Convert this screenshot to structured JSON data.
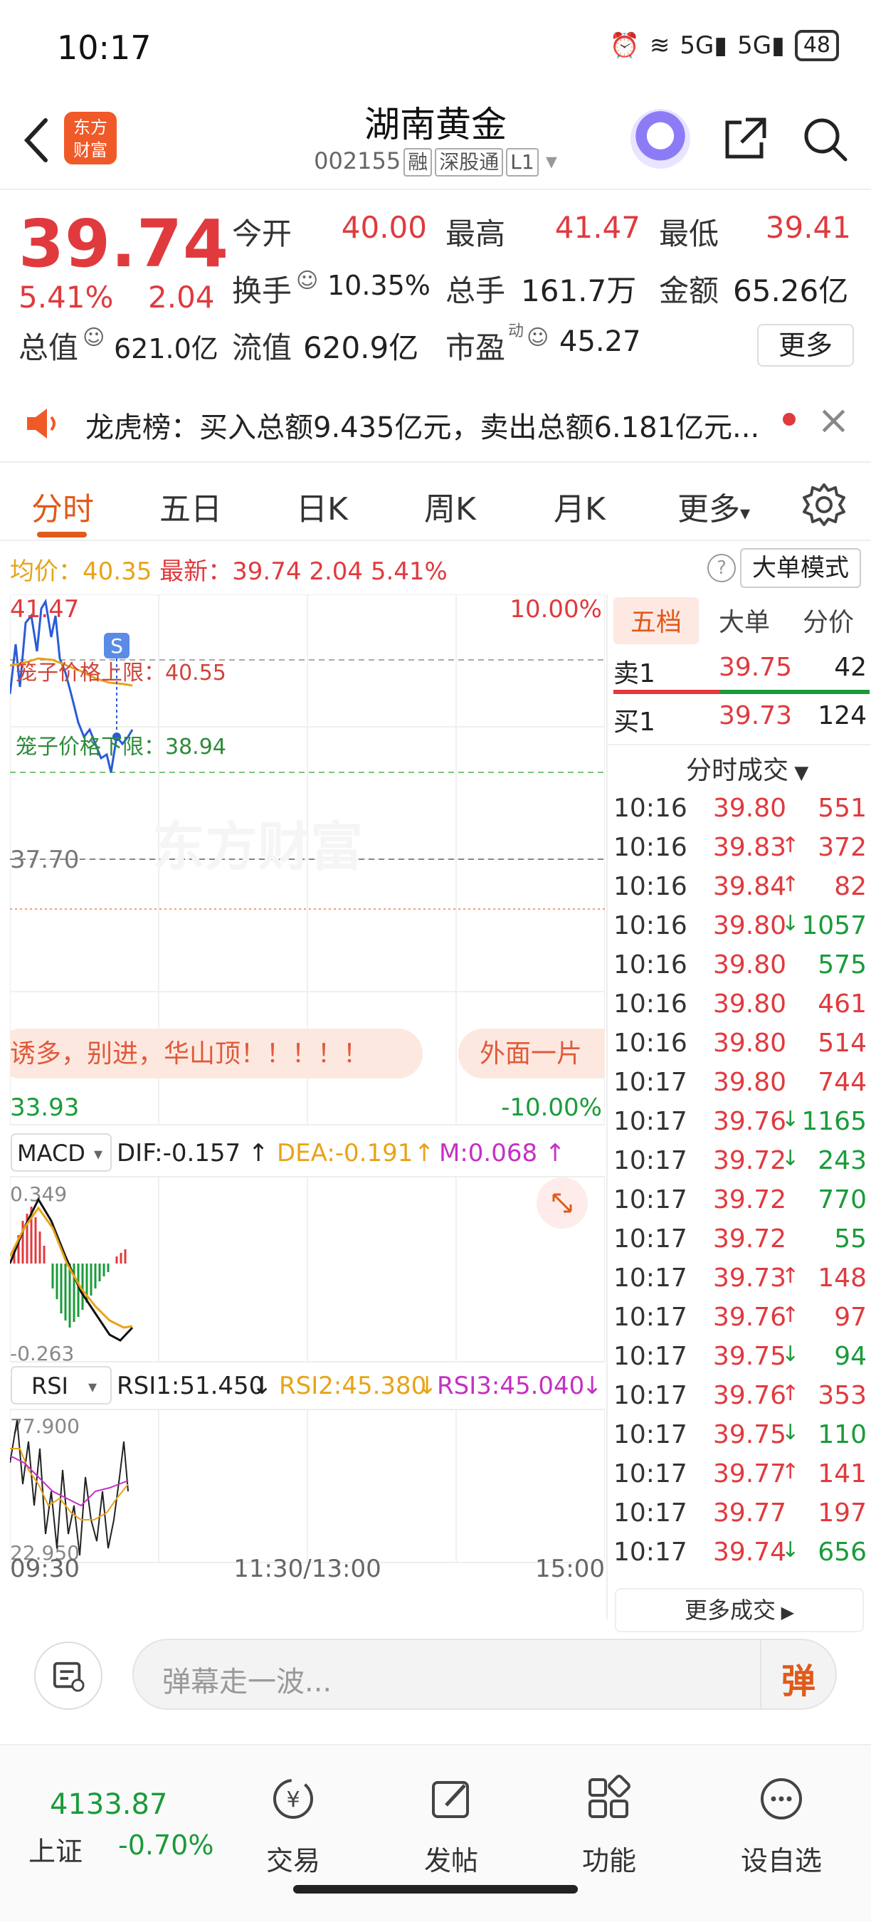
{
  "status_bar": {
    "time": "10:17",
    "signal_1": "5G",
    "signal_2": "5G",
    "battery": "48"
  },
  "header": {
    "logo_text": "东方\n财富",
    "stock_name": "湖南黄金",
    "stock_code": "002155",
    "tags": [
      "融",
      "深股通",
      "L1"
    ]
  },
  "quote": {
    "price": "39.74",
    "change_pct": "5.41%",
    "change": "2.04",
    "stats": [
      {
        "label": "今开",
        "value": "40.00",
        "color": "red"
      },
      {
        "label": "最高",
        "value": "41.47",
        "color": "red"
      },
      {
        "label": "最低",
        "value": "39.41",
        "color": "red"
      },
      {
        "label": "换手",
        "value": "10.35%",
        "color": "dark"
      },
      {
        "label": "总手",
        "value": "161.7万",
        "color": "dark"
      },
      {
        "label": "金额",
        "value": "65.26亿",
        "color": "dark"
      },
      {
        "label": "总值",
        "value": "621.0亿",
        "color": "dark"
      },
      {
        "label": "流值",
        "value": "620.9亿",
        "color": "dark"
      },
      {
        "label": "市盈",
        "value": "45.27",
        "color": "dark"
      }
    ],
    "pe_superscript": "动",
    "more_label": "更多"
  },
  "notice": {
    "text": "龙虎榜：买入总额9.435亿元，卖出总额6.181亿元..."
  },
  "tabs": [
    "分时",
    "五日",
    "日K",
    "周K",
    "月K",
    "更多"
  ],
  "info_line": {
    "avg_label": "均价：",
    "avg_value": "40.35",
    "latest_label": "最新：",
    "latest_value": "39.74",
    "change": "2.04",
    "change_pct": "5.41%",
    "mode_button": "大单模式"
  },
  "chart": {
    "top_price": "41.47",
    "top_pct": "10.00%",
    "cage_upper": "笼子价格上限：40.55",
    "cage_lower": "笼子价格下限：38.94",
    "mid_price": "37.70",
    "bottom_price": "33.93",
    "bottom_pct": "-10.00%",
    "watermark": "东方财富",
    "danmu_1": "诱多，别进，华山顶！！！！！",
    "danmu_2": "外面一片",
    "marker": "S",
    "macd": {
      "name": "MACD",
      "dif": "DIF:-0.157",
      "dea": "DEA:-0.191",
      "m": "M:0.068",
      "top": "0.349",
      "bottom": "-0.263"
    },
    "rsi": {
      "name": "RSI",
      "rsi1": "RSI1:51.450",
      "rsi2": "RSI2:45.380",
      "rsi3": "RSI3:45.040",
      "top": "77.900",
      "bottom": "22.950"
    },
    "time_axis": [
      "09:30",
      "11:30/13:00",
      "15:00"
    ]
  },
  "right_panel": {
    "tabs": [
      "五档",
      "大单",
      "分价"
    ],
    "sell1": {
      "label": "卖1",
      "price": "39.75",
      "vol": "42"
    },
    "buy1": {
      "label": "买1",
      "price": "39.73",
      "vol": "124"
    },
    "trades_title": "分时成交",
    "trades": [
      {
        "t": "10:16",
        "p": "39.80",
        "arrow": "",
        "v": "551",
        "vc": "red"
      },
      {
        "t": "10:16",
        "p": "39.83",
        "arrow": "↑",
        "v": "372",
        "vc": "red"
      },
      {
        "t": "10:16",
        "p": "39.84",
        "arrow": "↑",
        "v": "82",
        "vc": "red"
      },
      {
        "t": "10:16",
        "p": "39.80",
        "arrow": "↓",
        "v": "1057",
        "vc": "green"
      },
      {
        "t": "10:16",
        "p": "39.80",
        "arrow": "",
        "v": "575",
        "vc": "green"
      },
      {
        "t": "10:16",
        "p": "39.80",
        "arrow": "",
        "v": "461",
        "vc": "red"
      },
      {
        "t": "10:16",
        "p": "39.80",
        "arrow": "",
        "v": "514",
        "vc": "red"
      },
      {
        "t": "10:17",
        "p": "39.80",
        "arrow": "",
        "v": "744",
        "vc": "red"
      },
      {
        "t": "10:17",
        "p": "39.76",
        "arrow": "↓",
        "v": "1165",
        "vc": "green"
      },
      {
        "t": "10:17",
        "p": "39.72",
        "arrow": "↓",
        "v": "243",
        "vc": "green"
      },
      {
        "t": "10:17",
        "p": "39.72",
        "arrow": "",
        "v": "770",
        "vc": "green"
      },
      {
        "t": "10:17",
        "p": "39.72",
        "arrow": "",
        "v": "55",
        "vc": "green"
      },
      {
        "t": "10:17",
        "p": "39.73",
        "arrow": "↑",
        "v": "148",
        "vc": "red"
      },
      {
        "t": "10:17",
        "p": "39.76",
        "arrow": "↑",
        "v": "97",
        "vc": "red"
      },
      {
        "t": "10:17",
        "p": "39.75",
        "arrow": "↓",
        "v": "94",
        "vc": "green"
      },
      {
        "t": "10:17",
        "p": "39.76",
        "arrow": "↑",
        "v": "353",
        "vc": "red"
      },
      {
        "t": "10:17",
        "p": "39.75",
        "arrow": "↓",
        "v": "110",
        "vc": "green"
      },
      {
        "t": "10:17",
        "p": "39.77",
        "arrow": "↑",
        "v": "141",
        "vc": "red"
      },
      {
        "t": "10:17",
        "p": "39.77",
        "arrow": "",
        "v": "197",
        "vc": "red"
      },
      {
        "t": "10:17",
        "p": "39.74",
        "arrow": "↓",
        "v": "656",
        "vc": "green"
      }
    ],
    "more_trades": "更多成交"
  },
  "danmu_bar": {
    "placeholder": "弹幕走一波...",
    "send_label": "弹"
  },
  "bottom_nav": {
    "index_value": "4133.87",
    "index_name": "上证",
    "index_change": "-0.70%",
    "items": [
      "交易",
      "发帖",
      "功能",
      "设自选"
    ]
  },
  "colors": {
    "up": "#e03a3e",
    "down": "#1a9b3a",
    "accent": "#e05a1a",
    "avg": "#e8a317"
  }
}
